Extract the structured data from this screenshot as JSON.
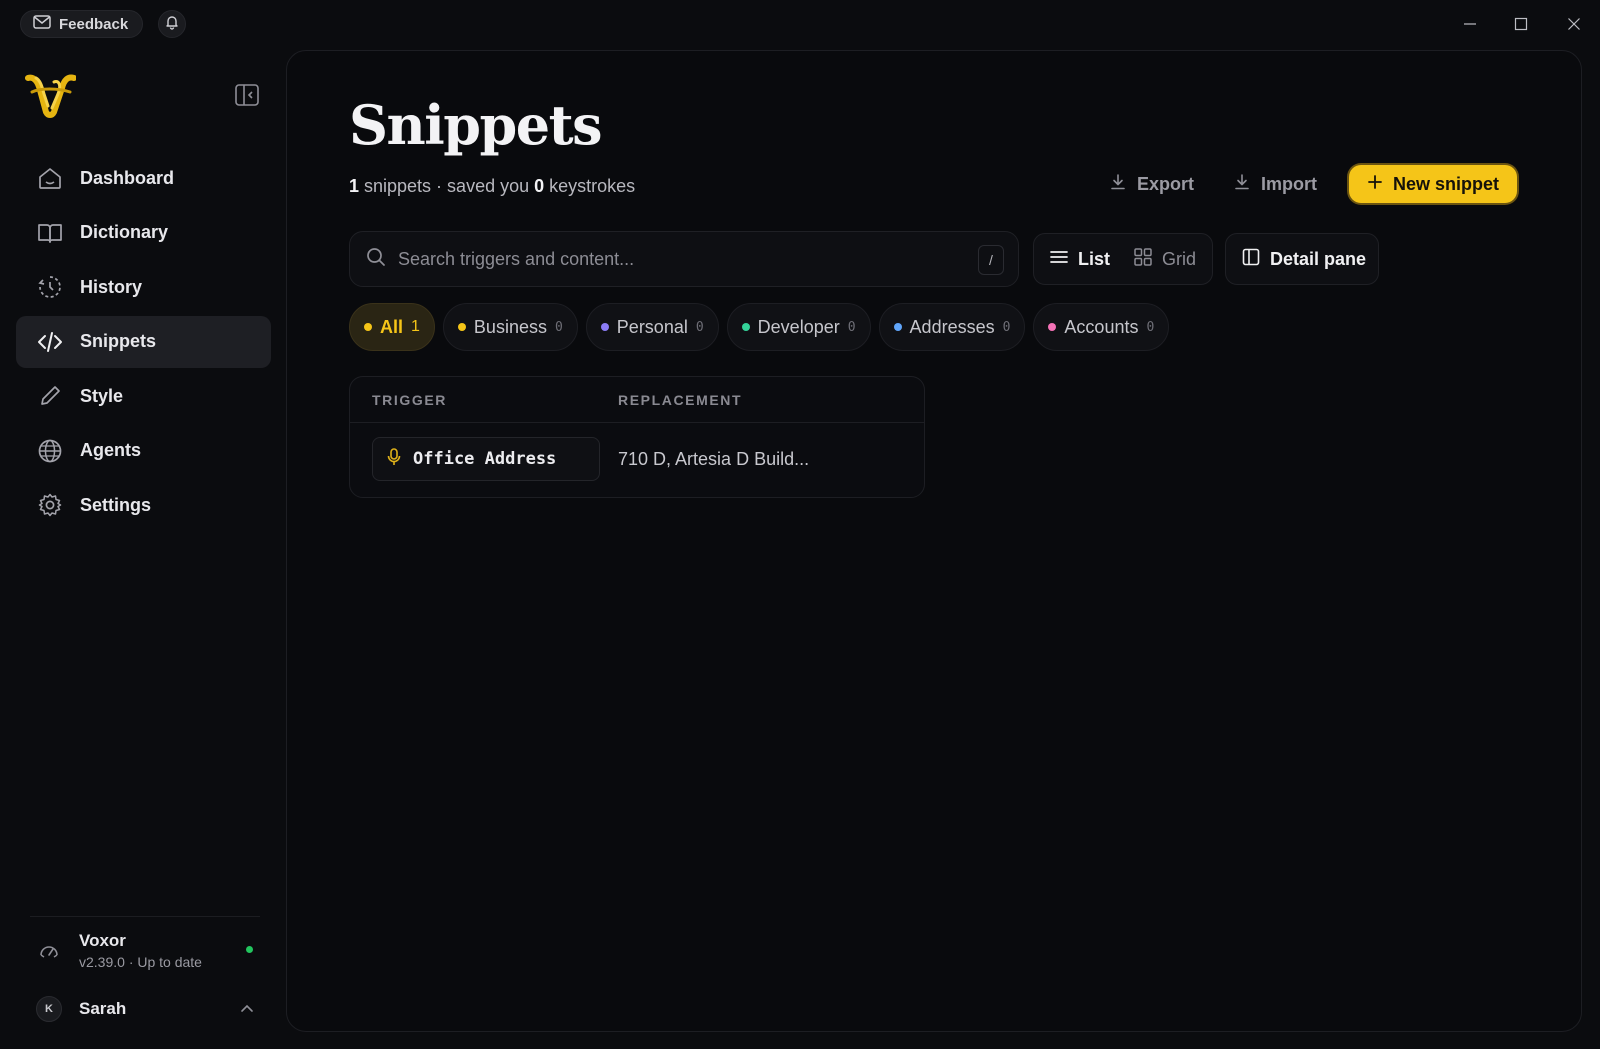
{
  "topbar": {
    "feedback_label": "Feedback",
    "feedback_icon": "mail-icon",
    "bell_icon": "bell-icon"
  },
  "sidebar": {
    "logo": "voxor-logo",
    "items": [
      {
        "label": "Dashboard",
        "icon": "home-icon",
        "active": false
      },
      {
        "label": "Dictionary",
        "icon": "book-icon",
        "active": false
      },
      {
        "label": "History",
        "icon": "history-icon",
        "active": false
      },
      {
        "label": "Snippets",
        "icon": "code-icon",
        "active": true
      },
      {
        "label": "Style",
        "icon": "pen-icon",
        "active": false
      },
      {
        "label": "Agents",
        "icon": "globe-icon",
        "active": false
      },
      {
        "label": "Settings",
        "icon": "gear-icon",
        "active": false
      }
    ],
    "app": {
      "name": "Voxor",
      "version_status": "v2.39.0 · Up to date"
    },
    "user": {
      "initial": "K",
      "name": "Sarah"
    }
  },
  "main": {
    "title": "Snippets",
    "summary": {
      "count": "1",
      "mid_text": " snippets · saved you ",
      "keystrokes": "0",
      "end_text": " keystrokes"
    },
    "actions": {
      "export": "Export",
      "import": "Import",
      "new_snippet": "New snippet"
    },
    "search": {
      "placeholder": "Search triggers and content...",
      "shortcut": "/"
    },
    "view": {
      "list": "List",
      "grid": "Grid",
      "detail_pane": "Detail pane"
    },
    "categories": [
      {
        "label": "All",
        "count": "1",
        "color": "#f5c518",
        "active": true
      },
      {
        "label": "Business",
        "count": "0",
        "color": "#f5c518",
        "active": false
      },
      {
        "label": "Personal",
        "count": "0",
        "color": "#8b7cf6",
        "active": false
      },
      {
        "label": "Developer",
        "count": "0",
        "color": "#34d399",
        "active": false
      },
      {
        "label": "Addresses",
        "count": "0",
        "color": "#60a5fa",
        "active": false
      },
      {
        "label": "Accounts",
        "count": "0",
        "color": "#f472b6",
        "active": false
      }
    ],
    "table": {
      "headers": [
        "TRIGGER",
        "REPLACEMENT"
      ],
      "rows": [
        {
          "trigger": "Office Address",
          "replacement": "710 D, Artesia D Build..."
        }
      ]
    }
  },
  "colors": {
    "accent": "#f5c518",
    "background": "#0b0c0f",
    "status_ok": "#22c55e"
  }
}
